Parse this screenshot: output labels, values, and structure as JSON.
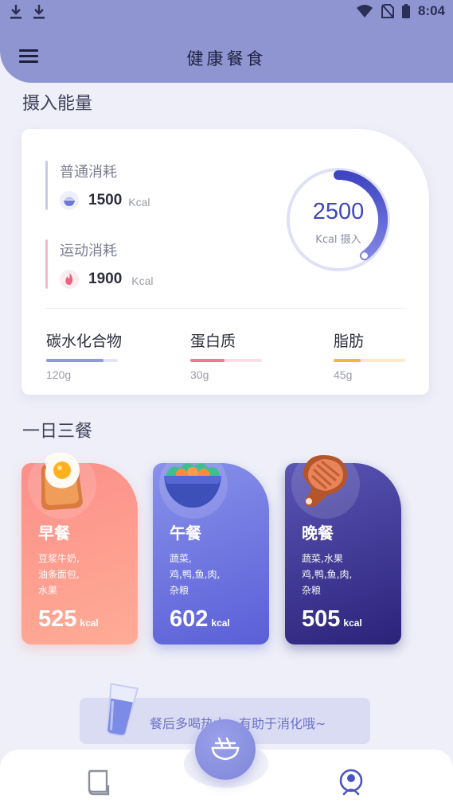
{
  "status_bar": {
    "time": "8:04"
  },
  "header": {
    "title": "健康餐食",
    "menu_icon": "menu-icon"
  },
  "energy": {
    "section_title": "摄入能量",
    "normal": {
      "label": "普通消耗",
      "value": "1500",
      "unit": "Kcal",
      "color": "#c5cbe9"
    },
    "sport": {
      "label": "运动消耗",
      "value": "1900",
      "unit": "Kcal",
      "color": "#f4b9c9"
    },
    "intake": {
      "value": "2500",
      "label": "Kcal 摄入",
      "progress": 0.4
    },
    "nutrients": [
      {
        "name": "碳水化合物",
        "value": "120g",
        "fill": 0.8,
        "color": "#8e98dc",
        "track": "#e2e5f6"
      },
      {
        "name": "蛋白质",
        "value": "30g",
        "fill": 0.48,
        "color": "#f07895",
        "track": "#fbdde5"
      },
      {
        "name": "脂肪",
        "value": "45g",
        "fill": 0.38,
        "color": "#f2b640",
        "track": "#fbe9c9"
      }
    ]
  },
  "meals": {
    "section_title": "一日三餐",
    "items": [
      {
        "name": "早餐",
        "desc": [
          "豆浆牛奶,",
          "油条面包,",
          "水果"
        ],
        "kcal": "525",
        "unit": "kcal",
        "icon": "egg-toast-icon"
      },
      {
        "name": "午餐",
        "desc": [
          "蔬菜,",
          "鸡,鸭,鱼,肉,",
          "杂粮"
        ],
        "kcal": "602",
        "unit": "kcal",
        "icon": "salad-bowl-icon"
      },
      {
        "name": "晚餐",
        "desc": [
          "蔬菜,水果",
          "鸡,鸭,鱼,肉,",
          "杂粮"
        ],
        "kcal": "505",
        "unit": "kcal",
        "icon": "steak-icon"
      }
    ]
  },
  "tip": {
    "text": "餐后多喝热水，有助于消化哦~"
  },
  "bottom_nav": {
    "left": "book-icon",
    "center": "meal-bowl-icon",
    "right": "profile-icon"
  }
}
